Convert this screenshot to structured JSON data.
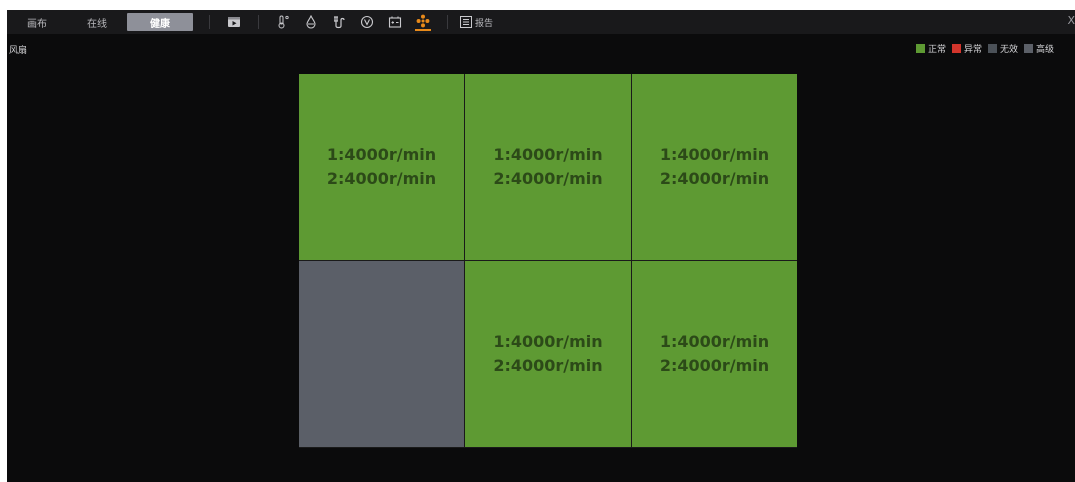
{
  "toolbar": {
    "tabs": [
      {
        "label": "画布",
        "active": false
      },
      {
        "label": "在线",
        "active": false
      },
      {
        "label": "健康",
        "active": true
      }
    ],
    "tools": [
      "monitor-icon",
      "thermometer-icon",
      "droplet-icon",
      "plug-icon",
      "voltage-icon",
      "battery-icon",
      "fan-icon"
    ],
    "active_tool": "fan-icon",
    "report_label": "报告",
    "close_label": "X"
  },
  "section": {
    "title": "风扇"
  },
  "legend": [
    {
      "label": "正常",
      "color": "#5e9a33"
    },
    {
      "label": "异常",
      "color": "#d2352c"
    },
    {
      "label": "无效",
      "color": "#4b5158"
    },
    {
      "label": "高级",
      "color": "#5c6068"
    }
  ],
  "colors": {
    "normal": "#5e9a33",
    "invalid": "#5b5f68",
    "accent": "#e88a1a"
  },
  "fans": [
    {
      "status": "normal",
      "line1": "1:4000r/min",
      "line2": "2:4000r/min"
    },
    {
      "status": "normal",
      "line1": "1:4000r/min",
      "line2": "2:4000r/min"
    },
    {
      "status": "normal",
      "line1": "1:4000r/min",
      "line2": "2:4000r/min"
    },
    {
      "status": "invalid",
      "line1": "",
      "line2": ""
    },
    {
      "status": "normal",
      "line1": "1:4000r/min",
      "line2": "2:4000r/min"
    },
    {
      "status": "normal",
      "line1": "1:4000r/min",
      "line2": "2:4000r/min"
    }
  ]
}
